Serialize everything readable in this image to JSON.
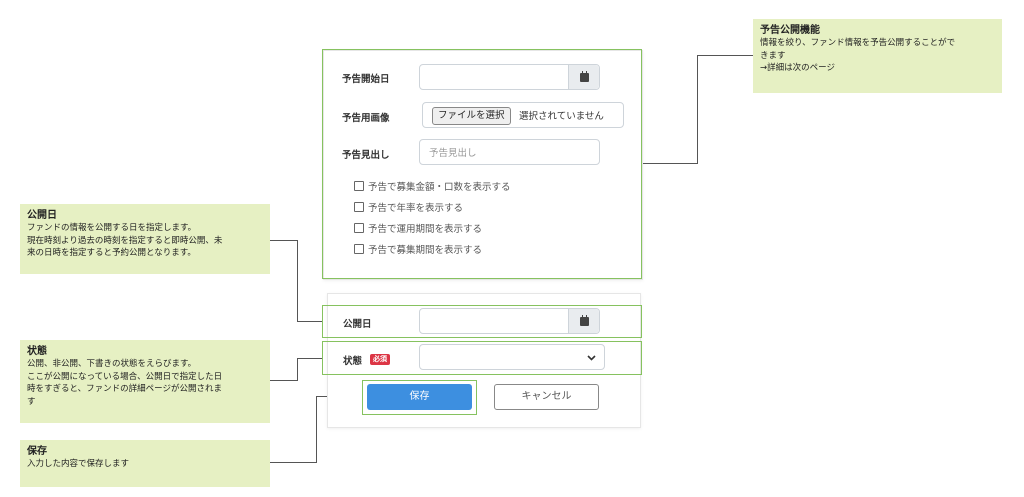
{
  "notes": {
    "preview": {
      "title": "予告公開機能",
      "lines": [
        "情報を絞り、ファンド情報を予告公開することがで",
        "きます",
        "→詳細は次のページ"
      ]
    },
    "publish_date": {
      "title": "公開日",
      "lines": [
        "ファンドの情報を公開する日を指定します。",
        "現在時刻より過去の時刻を指定すると即時公開、未",
        "来の日時を指定すると予約公開となります。"
      ]
    },
    "status": {
      "title": "状態",
      "lines": [
        "公開、非公開、下書きの状態をえらびます。",
        "ここが公開になっている場合、公開日で指定した日",
        "時をすぎると、ファンドの詳細ページが公開されま",
        "す"
      ]
    },
    "save": {
      "title": "保存",
      "lines": [
        "入力した内容で保存します"
      ]
    }
  },
  "form": {
    "preview_start_label": "予告開始日",
    "preview_image_label": "予告用画像",
    "file_button": "ファイルを選択",
    "file_status": "選択されていません",
    "preview_heading_label": "予告見出し",
    "preview_heading_placeholder": "予告見出し",
    "checkboxes": [
      "予告で募集金額・口数を表示する",
      "予告で年率を表示する",
      "予告で運用期間を表示する",
      "予告で募集期間を表示する"
    ],
    "publish_date_label": "公開日",
    "status_label": "状態",
    "required_badge": "必須",
    "save_button": "保存",
    "cancel_button": "キャンセル"
  },
  "colors": {
    "accent": "#3d8fe0",
    "note_bg": "#e6f0c3",
    "frame": "#86c25f",
    "required": "#dc3545"
  }
}
